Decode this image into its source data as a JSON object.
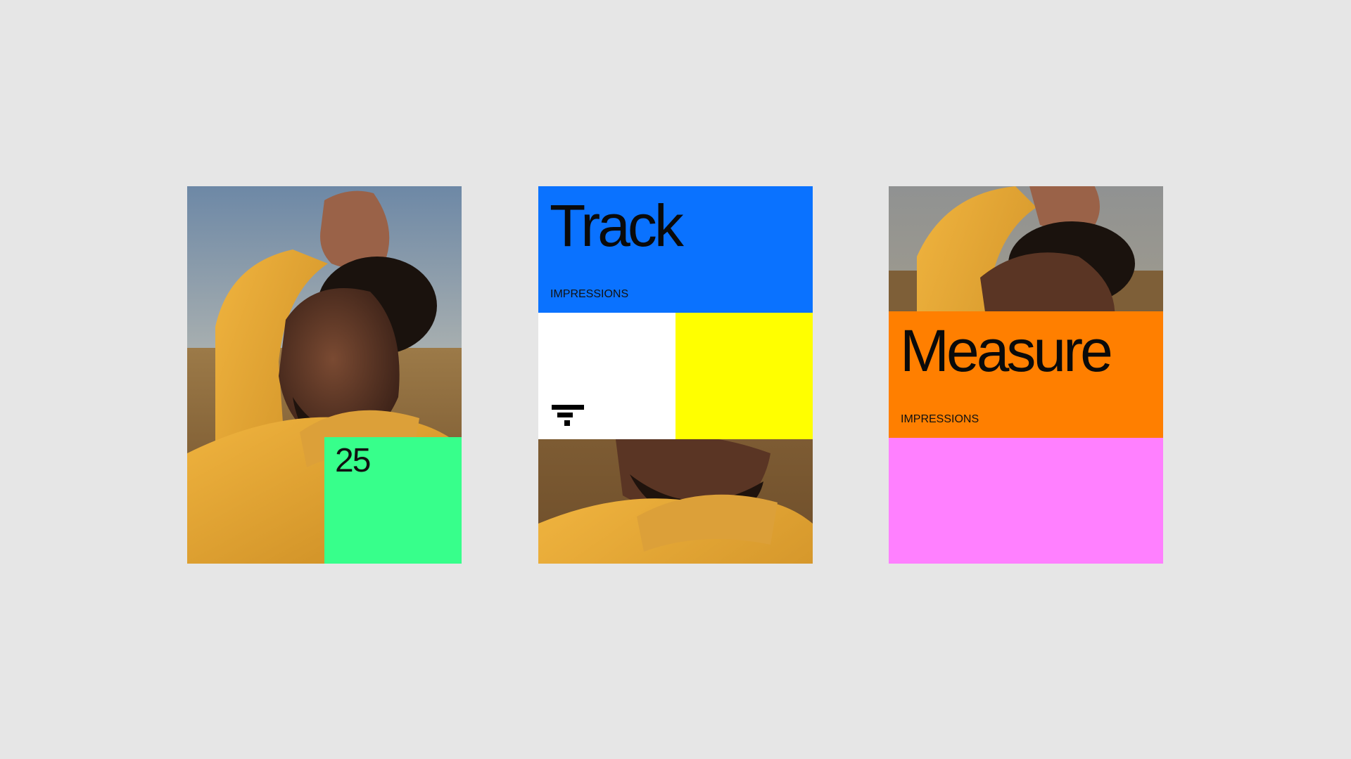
{
  "cards": [
    {
      "number": "25",
      "colors": {
        "block": "#37ff8b"
      }
    },
    {
      "title": "Track",
      "label": "IMPRESSIONS",
      "colors": {
        "top": "#0a72ff",
        "left": "#ffffff",
        "right": "#ffff00"
      },
      "icon": "stacked-bars-logo-icon"
    },
    {
      "title": "Measure",
      "label": "IMPRESSIONS",
      "colors": {
        "middle": "#ff7f00",
        "bottom": "#ff80ff"
      }
    }
  ],
  "colors": {
    "background": "#e6e6e6",
    "jacket": "#e8a93a",
    "skin": "#5a3524"
  }
}
